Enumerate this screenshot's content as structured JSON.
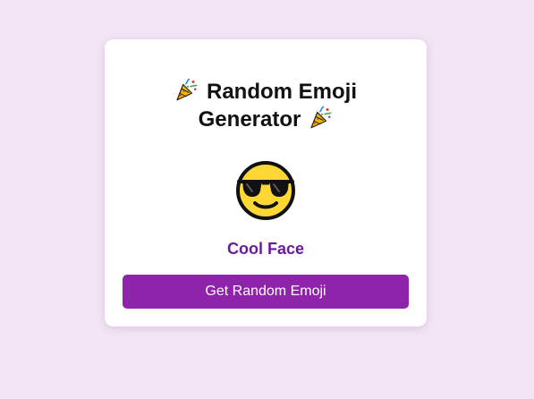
{
  "app": {
    "title_line1": "Random Emoji",
    "title_line2": "Generator",
    "title_icon": "party-popper-icon"
  },
  "result": {
    "emoji_icon": "smiling-face-with-sunglasses-icon",
    "label": "Cool Face"
  },
  "actions": {
    "generate_label": "Get Random Emoji"
  },
  "colors": {
    "background": "#f3e5f5",
    "card": "#ffffff",
    "accent": "#8e24aa",
    "label": "#6a1b9a"
  }
}
